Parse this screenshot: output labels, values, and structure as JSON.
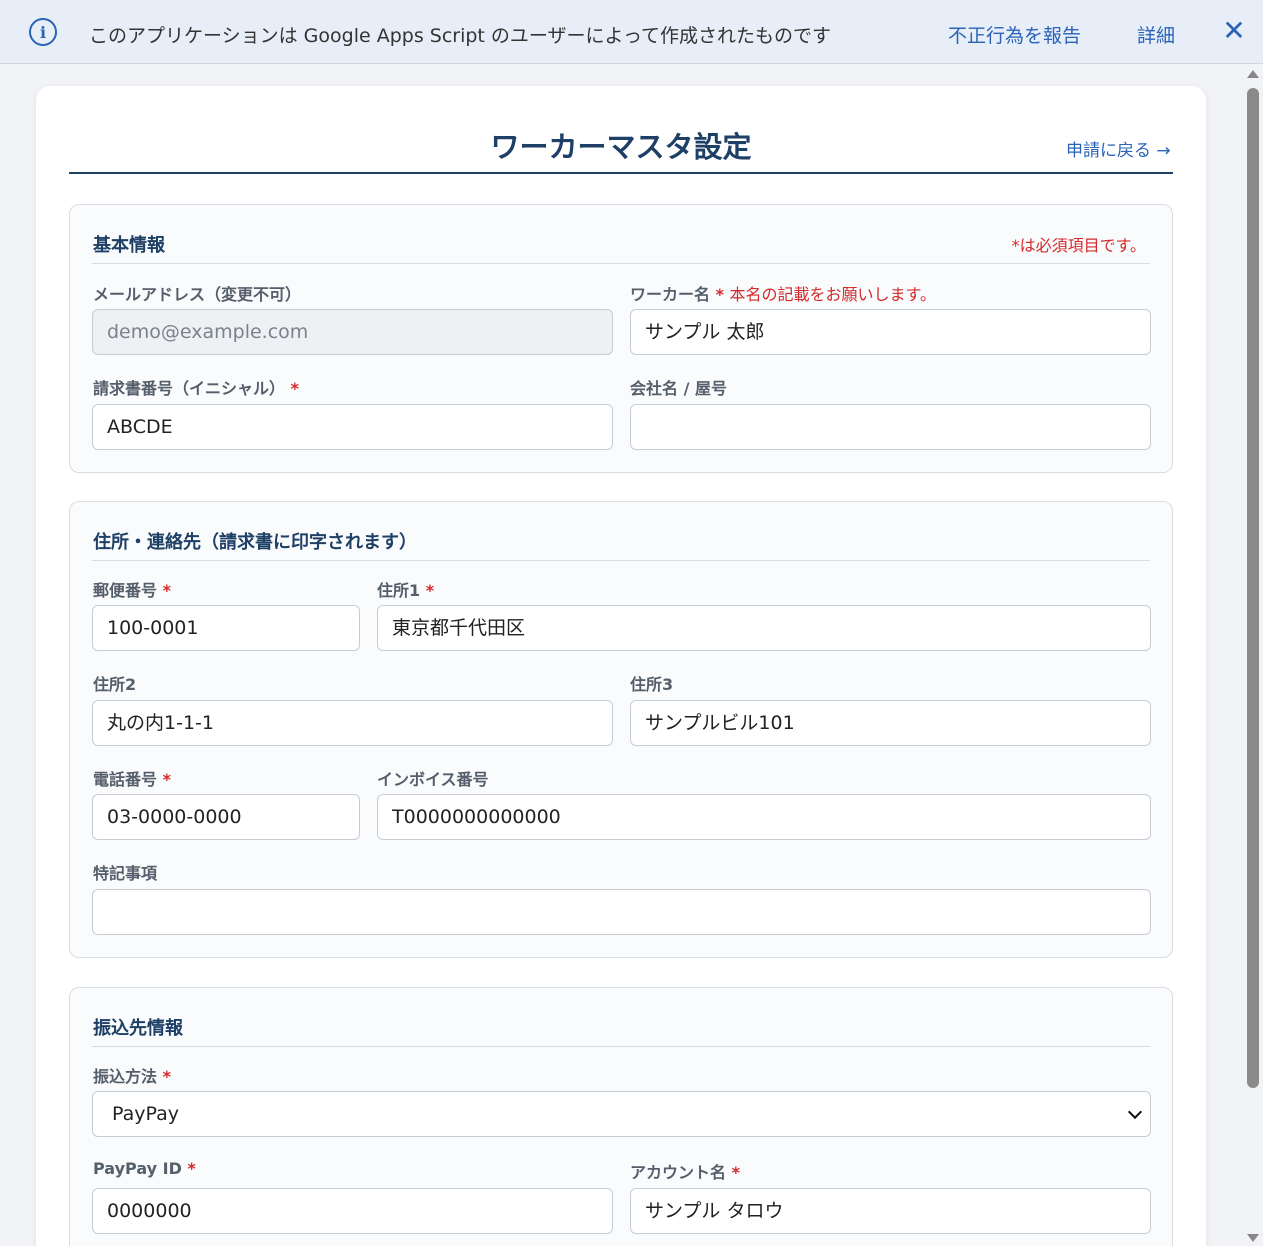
{
  "banner": {
    "message": "このアプリケーションは Google Apps Script のユーザーによって作成されたものです",
    "report_link": "不正行為を報告",
    "details_link": "詳細",
    "close_label": "✕"
  },
  "page": {
    "title": "ワーカーマスタ設定",
    "back_link": "申請に戻る →"
  },
  "basic": {
    "title": "基本情報",
    "required_note": "*は必須項目です。",
    "email_label": "メールアドレス（変更不可）",
    "email_value": "demo@example.com",
    "worker_name_label": "ワーカー名",
    "worker_name_req": "*",
    "worker_name_hint": "本名の記載をお願いします。",
    "worker_name_value": "サンプル 太郎",
    "invoice_initial_label": "請求書番号（イニシャル）",
    "invoice_initial_req": "*",
    "invoice_initial_value": "ABCDE",
    "company_label": "会社名 / 屋号",
    "company_value": ""
  },
  "address": {
    "title": "住所・連絡先（請求書に印字されます）",
    "postal_label": "郵便番号",
    "postal_req": "*",
    "postal_value": "100-0001",
    "addr1_label": "住所1",
    "addr1_req": "*",
    "addr1_value": "東京都千代田区",
    "addr2_label": "住所2",
    "addr2_value": "丸の内1-1-1",
    "addr3_label": "住所3",
    "addr3_value": "サンプルビル101",
    "phone_label": "電話番号",
    "phone_req": "*",
    "phone_value": "03-0000-0000",
    "invoice_no_label": "インボイス番号",
    "invoice_no_value": "T0000000000000",
    "notes_label": "特記事項",
    "notes_value": ""
  },
  "bank": {
    "title": "振込先情報",
    "method_label": "振込方法",
    "method_req": "*",
    "method_value": "PayPay",
    "paypay_id_label": "PayPay ID",
    "paypay_id_req": "*",
    "paypay_id_value": "0000000",
    "account_name_label": "アカウント名",
    "account_name_req": "*",
    "account_name_value": "サンプル タロウ"
  }
}
